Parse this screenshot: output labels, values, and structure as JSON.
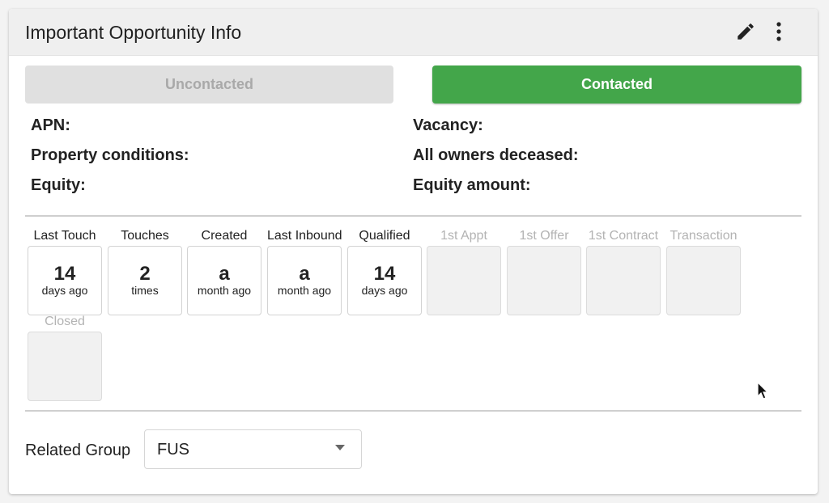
{
  "header": {
    "title": "Important Opportunity Info",
    "edit_icon": "pencil-icon",
    "menu_icon": "more-vert-icon"
  },
  "status_toggle": {
    "uncontacted_label": "Uncontacted",
    "contacted_label": "Contacted",
    "selected": "Contacted"
  },
  "fields": {
    "apn": "APN:",
    "vacancy": "Vacancy:",
    "property_conditions": "Property conditions:",
    "all_owners_deceased": "All owners deceased:",
    "equity": "Equity:",
    "equity_amount": "Equity amount:"
  },
  "milestones": [
    {
      "label": "Last Touch",
      "value": "14",
      "unit": "days ago"
    },
    {
      "label": "Touches",
      "value": "2",
      "unit": "times"
    },
    {
      "label": "Created",
      "value": "a",
      "unit": "month ago"
    },
    {
      "label": "Last Inbound",
      "value": "a",
      "unit": "month ago"
    },
    {
      "label": "Qualified",
      "value": "14",
      "unit": "days ago"
    },
    {
      "label": "1st Appt",
      "value": "",
      "unit": ""
    },
    {
      "label": "1st Offer",
      "value": "",
      "unit": ""
    },
    {
      "label": "1st Contract",
      "value": "",
      "unit": ""
    },
    {
      "label": "Transaction",
      "value": "",
      "unit": ""
    },
    {
      "label": "Closed",
      "value": "",
      "unit": ""
    }
  ],
  "related_group": {
    "label": "Related Group",
    "value": "FUS"
  },
  "colors": {
    "contacted_green": "#43a64a",
    "uncontacted_gray": "#e0e0e0",
    "disabled_box": "#f1f1f1"
  }
}
